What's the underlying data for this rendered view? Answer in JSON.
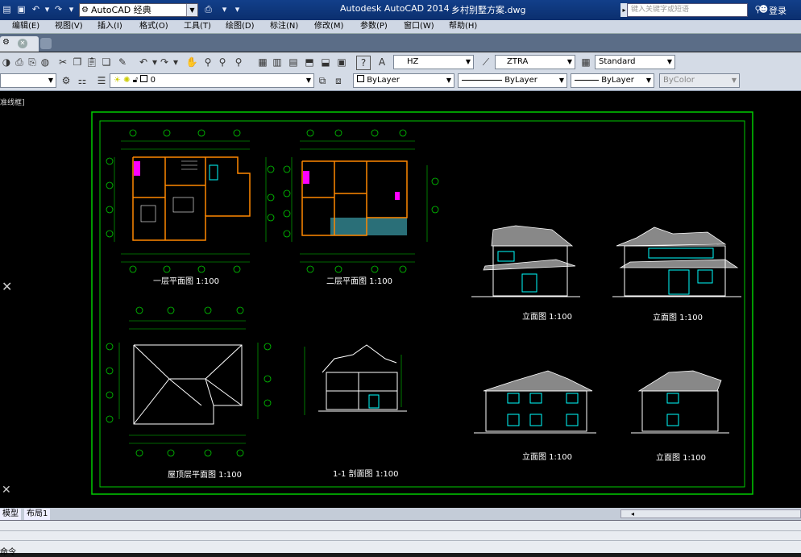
{
  "titlebar": {
    "workspace": "AutoCAD 经典",
    "app_title": "Autodesk AutoCAD 2014",
    "doc_title": "乡村别墅方案.dwg",
    "search_placeholder": "键入关键字或短语",
    "login": "登录"
  },
  "menu": [
    "编辑(E)",
    "视图(V)",
    "插入(I)",
    "格式(O)",
    "工具(T)",
    "绘图(D)",
    "标注(N)",
    "修改(M)",
    "参数(P)",
    "窗口(W)",
    "帮助(H)"
  ],
  "toolbar": {
    "text_style": "HZ",
    "dim_style": "ZTRA",
    "table_style": "Standard",
    "layer": "0",
    "color": "ByLayer",
    "linetype": "ByLayer",
    "lineweight": "ByLayer",
    "plotstyle": "ByColor"
  },
  "viewport": {
    "view_label": "准线框]"
  },
  "drawing": {
    "titles": {
      "plan1": "一层平面图 1:100",
      "plan2": "二层平面图 1:100",
      "roof": "屋顶层平面图 1:100",
      "section": "1-1 剖面图 1:100",
      "elev_a": "立面图 1:100",
      "elev_b": "立面图 1:100",
      "elev_c": "立面图 1:100",
      "elev_d": "立面图 1:100"
    }
  },
  "layout_tabs": [
    "模型",
    "布局1"
  ],
  "command": {
    "prompt": "命令"
  },
  "colors": {
    "frame": "#00ff00",
    "wall": "#ffffff",
    "axis": "#00ff00",
    "window": "#00ffff",
    "accent_magenta": "#ff00ff",
    "accent_orange": "#ff8800"
  }
}
